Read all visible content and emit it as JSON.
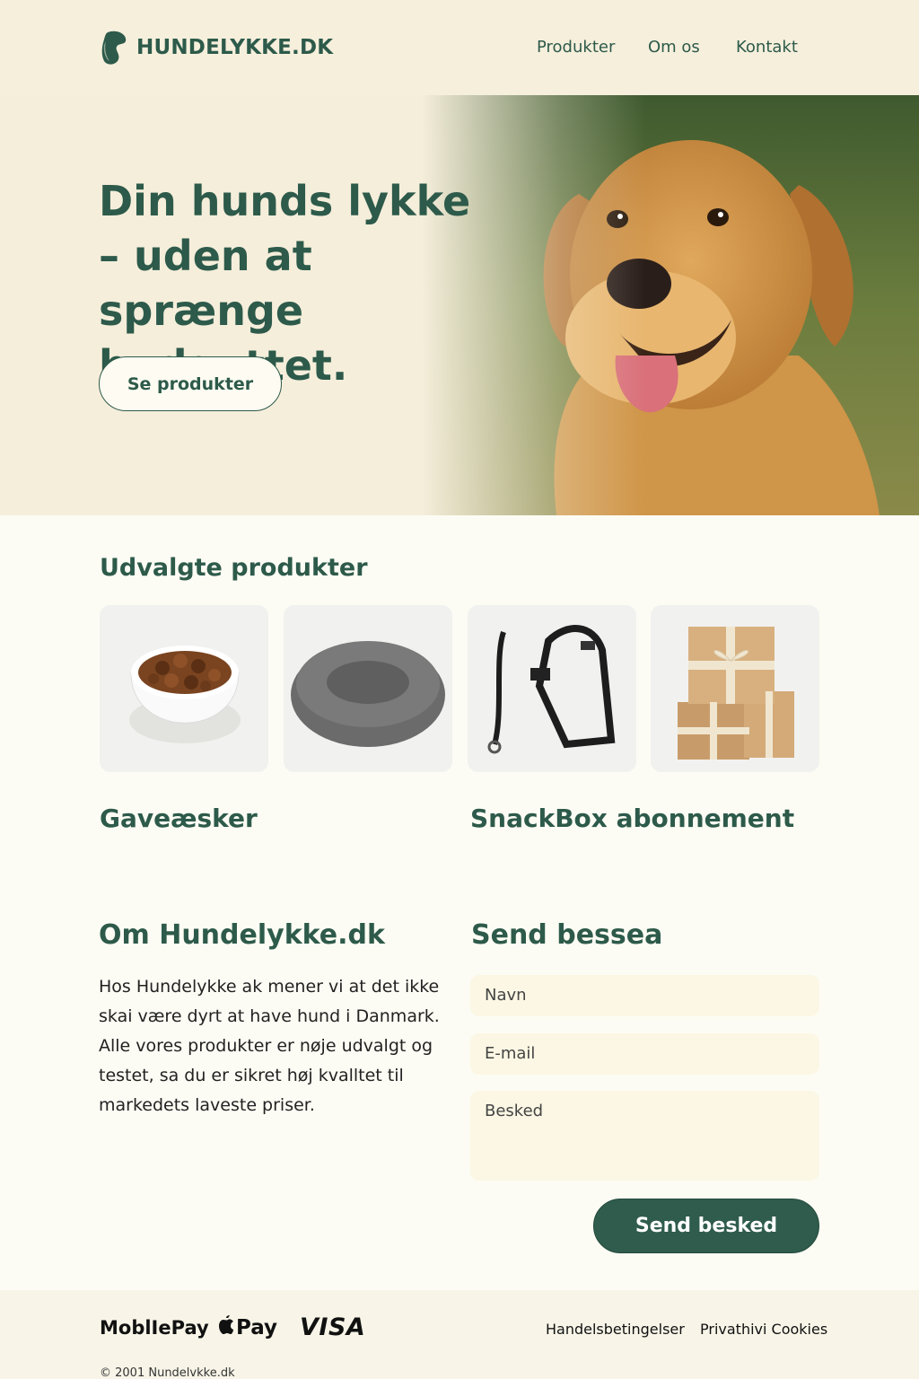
{
  "brand": {
    "name": "HUNDELYKKE.DK"
  },
  "nav": {
    "items": [
      "Produkter",
      "Om os",
      "Kontakt"
    ]
  },
  "hero": {
    "title": "Din hunds lykke – uden at sprænge budgettet.",
    "cta": "Se produkter"
  },
  "products": {
    "title": "Udvalgte produkter",
    "items": [
      "dog-food-bowl",
      "dog-bed",
      "harness-leash",
      "gift-boxes"
    ]
  },
  "categories": [
    "Gaveæsker",
    "SnackBox abonnement"
  ],
  "about": {
    "title": "Om Hundelykke.dk",
    "text": "Hos Hundelykke ak mener vi at det ikke skai være dyrt at have hund i Danmark. Alle vores produkter er nøje udvalgt og testet, sa du er sikret høj kvalltet til markedets laveste priser."
  },
  "contact": {
    "title": "Send bessea",
    "name_placeholder": "Navn",
    "email_placeholder": "E-mail",
    "message_placeholder": "Besked",
    "submit": "Send besked"
  },
  "footer": {
    "payments": [
      "MoblIePay",
      "Pay",
      "VISA"
    ],
    "links": [
      "Handelsbetingelser",
      "Privathivi Cookies"
    ],
    "copyright": "© 2001 Nundelvkke.dk"
  },
  "colors": {
    "primary": "#2d5a4a",
    "hero_bg": "#f5eedb",
    "page_bg": "#fdfcf4",
    "field_bg": "#fbf7e4"
  }
}
